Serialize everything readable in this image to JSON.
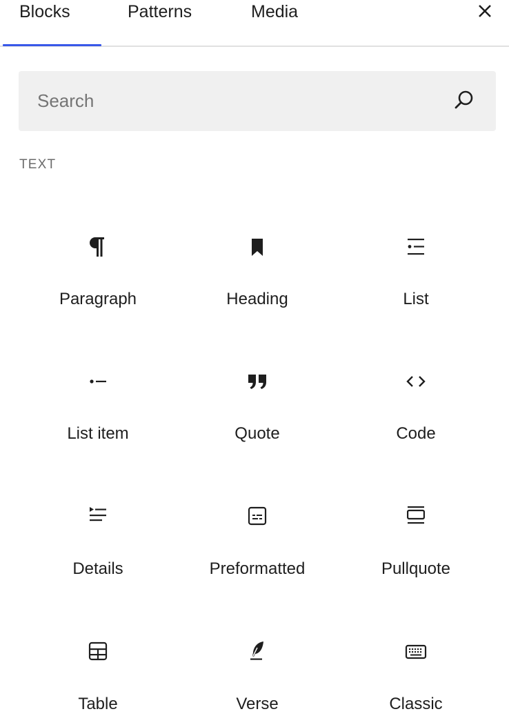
{
  "tabs": [
    {
      "label": "Blocks",
      "active": true
    },
    {
      "label": "Patterns",
      "active": false
    },
    {
      "label": "Media",
      "active": false
    }
  ],
  "close_icon": "close-icon",
  "search": {
    "placeholder": "Search",
    "value": "",
    "icon": "search-icon"
  },
  "category": {
    "title": "TEXT"
  },
  "blocks": [
    {
      "label": "Paragraph",
      "icon": "paragraph-icon"
    },
    {
      "label": "Heading",
      "icon": "bookmark-icon"
    },
    {
      "label": "List",
      "icon": "list-icon"
    },
    {
      "label": "List item",
      "icon": "list-item-icon"
    },
    {
      "label": "Quote",
      "icon": "quote-icon"
    },
    {
      "label": "Code",
      "icon": "code-icon"
    },
    {
      "label": "Details",
      "icon": "details-icon"
    },
    {
      "label": "Preformatted",
      "icon": "preformatted-icon"
    },
    {
      "label": "Pullquote",
      "icon": "pullquote-icon"
    },
    {
      "label": "Table",
      "icon": "table-icon"
    },
    {
      "label": "Verse",
      "icon": "verse-icon"
    },
    {
      "label": "Classic",
      "icon": "keyboard-icon"
    }
  ],
  "colors": {
    "accent": "#3858e9",
    "text": "#1e1e1e",
    "muted": "#6b6b6b",
    "search_bg": "#f0f0f0",
    "divider": "#e0e0e0"
  }
}
